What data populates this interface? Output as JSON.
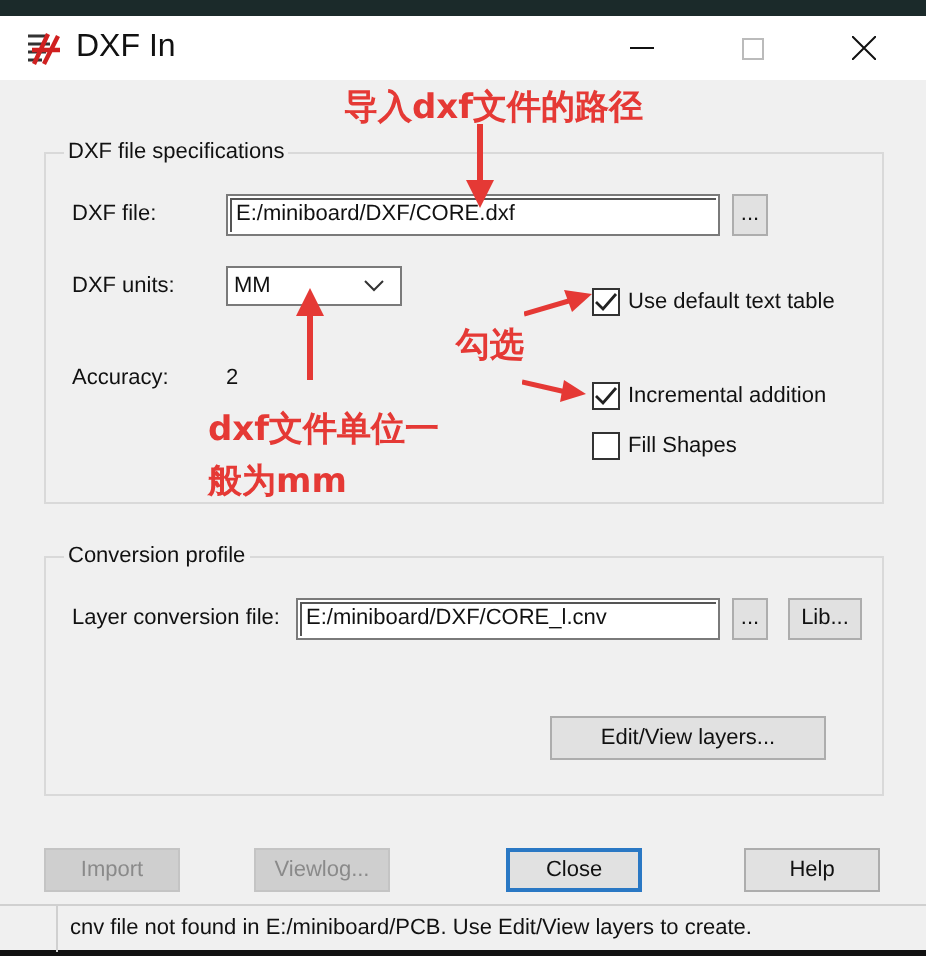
{
  "window": {
    "title": "DXF In"
  },
  "spec_group": {
    "title": "DXF file specifications",
    "dxf_file": {
      "label": "DXF file:",
      "value": "E:/miniboard/DXF/CORE.dxf",
      "browse": "..."
    },
    "units": {
      "label": "DXF units:",
      "value": "MM"
    },
    "accuracy": {
      "label": "Accuracy:",
      "value": "2"
    },
    "options": [
      {
        "label": "Use default text table",
        "checked": true
      },
      {
        "label": "Incremental addition",
        "checked": true
      },
      {
        "label": "Fill Shapes",
        "checked": false
      }
    ]
  },
  "profile_group": {
    "title": "Conversion profile",
    "layer_file": {
      "label": "Layer conversion file:",
      "value": "E:/miniboard/DXF/CORE_l.cnv",
      "browse": "...",
      "lib": "Lib..."
    },
    "edit_button": "Edit/View layers..."
  },
  "buttons": [
    {
      "label": "Import",
      "disabled": true,
      "default": false
    },
    {
      "label": "Viewlog...",
      "disabled": true,
      "default": false
    },
    {
      "label": "Close",
      "disabled": false,
      "default": true
    },
    {
      "label": "Help",
      "disabled": false,
      "default": false
    }
  ],
  "status_bar": "cnv file not found in E:/miniboard/PCB. Use Edit/View layers to create.",
  "annotations": [
    {
      "lines": [
        "导入dxf文件的路径"
      ]
    },
    {
      "lines": [
        "勾选"
      ]
    },
    {
      "lines": [
        "dxf文件单位一",
        "般为mm"
      ]
    }
  ]
}
